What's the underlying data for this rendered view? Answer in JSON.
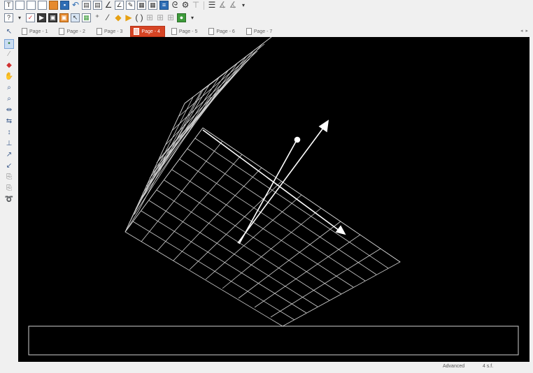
{
  "toolbar1": {
    "icons": [
      "text-icon",
      "page-icon",
      "page-icon",
      "page-icon",
      "open-folder-icon",
      "save-icon",
      "undo-icon",
      "chart-icon",
      "chart-icon",
      "angle-icon",
      "angle-icon",
      "edit-icon",
      "grid-icon",
      "table-icon",
      "list-icon",
      "snail-icon",
      "settings-icon",
      "lines-icon",
      "angle-measure-icon",
      "angle-measure-icon"
    ]
  },
  "toolbar2": {
    "icons": [
      "text-tool-icon",
      "checklist-icon",
      "media-icon",
      "image-icon",
      "image-icon",
      "select-icon",
      "grid-icon",
      "point-add-icon",
      "line-add-icon",
      "vector-add-icon",
      "arrow-add-icon",
      "function-icon",
      "grid-icon",
      "grid-icon",
      "grid-icon",
      "turtle-icon"
    ]
  },
  "tabs": [
    {
      "label": "Page - 1"
    },
    {
      "label": "Page - 2"
    },
    {
      "label": "Page - 3"
    },
    {
      "label": "Page - 4"
    },
    {
      "label": "Page - 5"
    },
    {
      "label": "Page - 6"
    },
    {
      "label": "Page - 7"
    }
  ],
  "active_tab": "Page - 4",
  "sidebar_tools": [
    "select-arrow-icon",
    "point-icon",
    "pencil-icon",
    "eraser-icon",
    "hand-icon",
    "zoom-in-icon",
    "zoom-out-icon",
    "move-horizontal-icon",
    "move-vertical-icon",
    "scale-x-icon",
    "scale-y-icon",
    "rotate-icon",
    "rotate-icon",
    "page-icon",
    "page-icon",
    "lasso-icon"
  ],
  "status": {
    "mode": "Advanced",
    "precision": "4 s.f."
  },
  "colors": {
    "canvas": "#000000",
    "active_tab": "#d64424",
    "grid": "#d8d8d8"
  }
}
